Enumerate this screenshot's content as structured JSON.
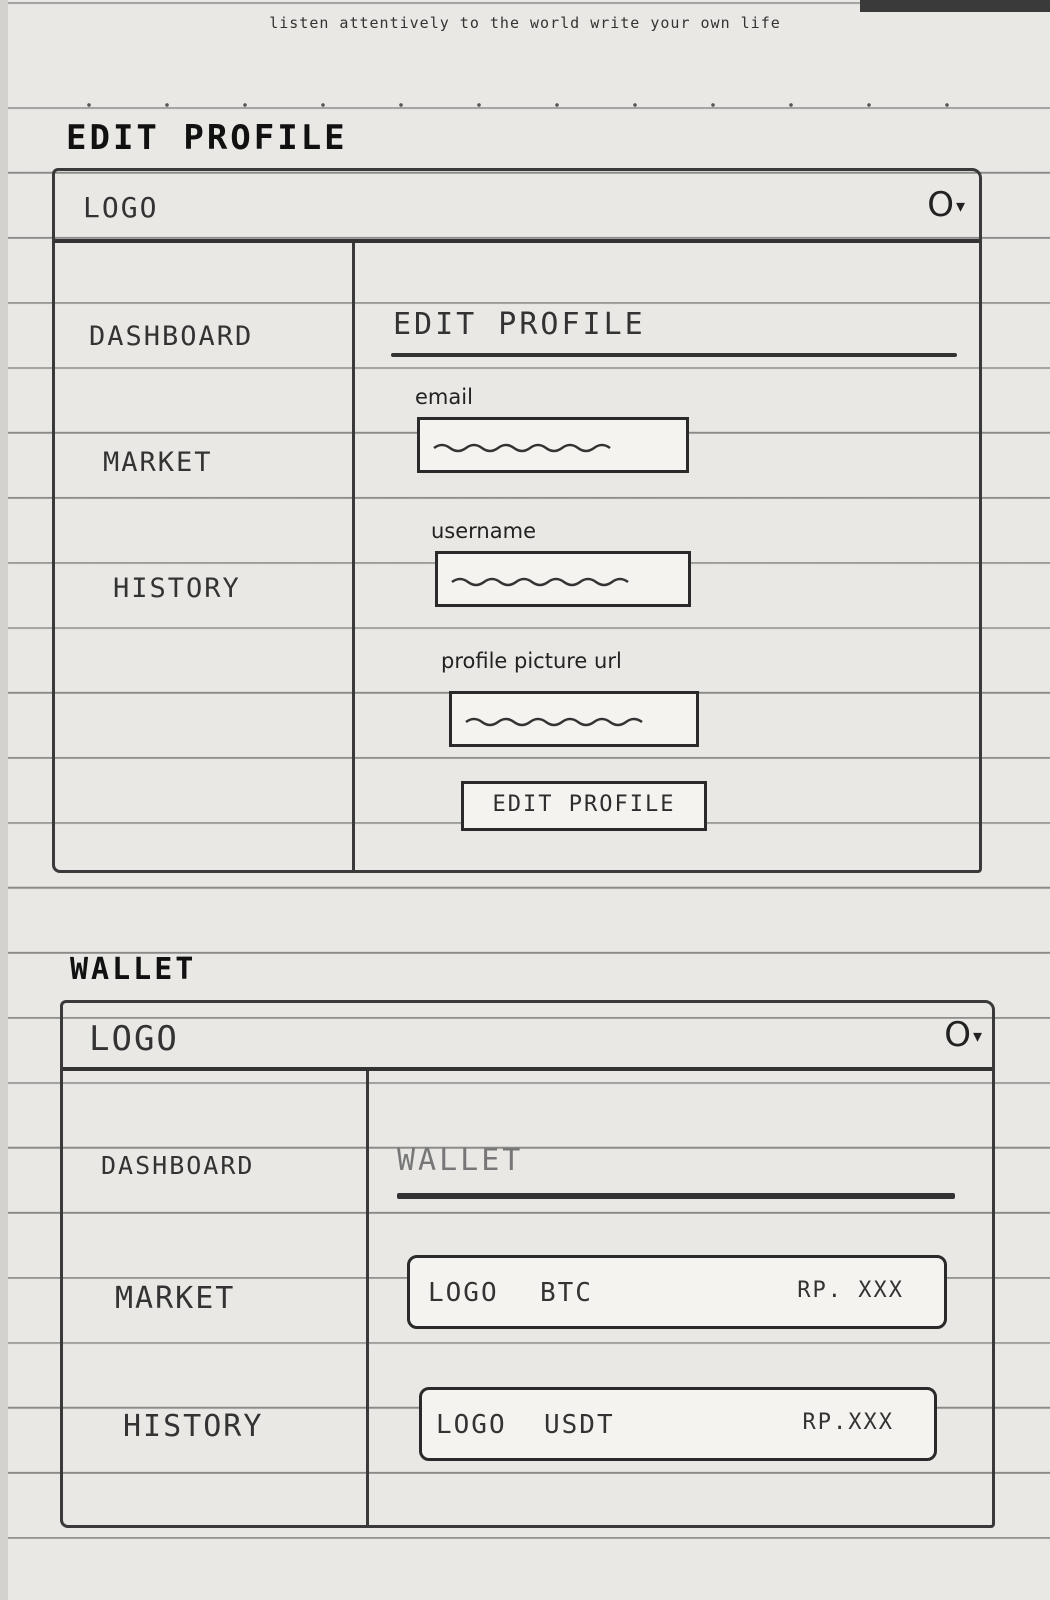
{
  "motto": "listen attentively to the world write your own life",
  "edit_section": {
    "title": "EDIT PROFILE",
    "header": {
      "logo": "LOGO",
      "user_icon": "user-icon",
      "caret": "▾"
    },
    "nav": [
      "DASHBOARD",
      "MARKET",
      "HISTORY"
    ],
    "content": {
      "title": "EDIT PROFILE",
      "fields": [
        {
          "label": "email"
        },
        {
          "label": "username"
        },
        {
          "label": "profile picture url"
        }
      ],
      "button": "EDIT PROFILE"
    }
  },
  "wallet_section": {
    "title": "WALLET",
    "header": {
      "logo": "LOGO",
      "user_icon": "user-icon",
      "caret": "▾"
    },
    "nav": [
      "DASHBOARD",
      "MARKET",
      "HISTORY"
    ],
    "content": {
      "title": "WALLET",
      "assets": [
        {
          "logo": "LOGO",
          "name": "BTC",
          "amount": "RP. XXX"
        },
        {
          "logo": "LOGO",
          "name": "USDT",
          "amount": "RP.XXX"
        }
      ]
    }
  }
}
